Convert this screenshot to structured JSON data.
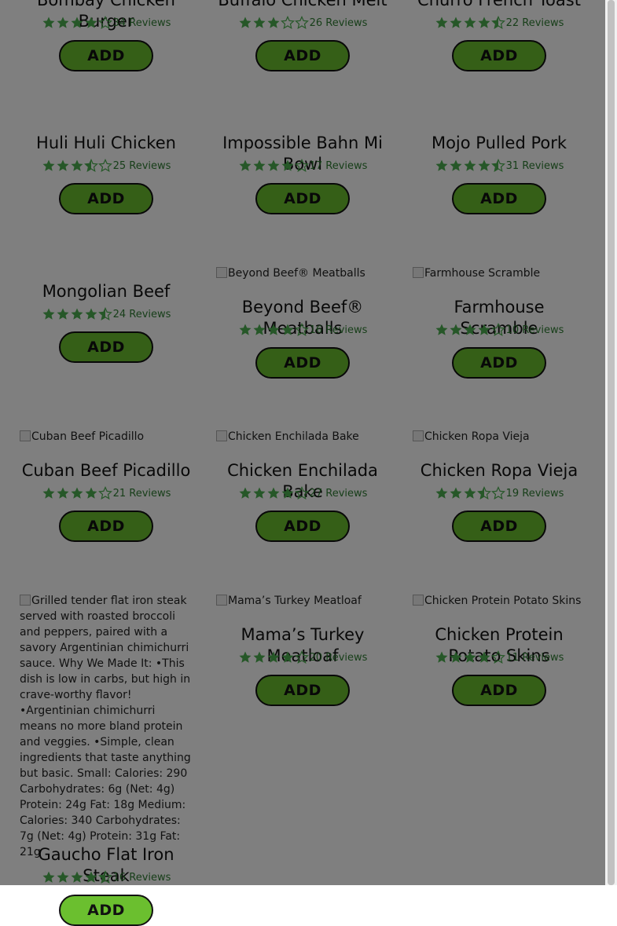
{
  "colors": {
    "star_fill": "#4caf50",
    "button_fill": "#6bbf2f",
    "overlay": "rgba(0,0,0,0.5)"
  },
  "add_label": "ADD",
  "products": [
    {
      "name": "Bombay Chicken Burger",
      "rating": 4,
      "reviews": "34 Reviews",
      "image_alt": ""
    },
    {
      "name": "Buffalo Chicken Melt",
      "rating": 3,
      "reviews": "26 Reviews",
      "image_alt": ""
    },
    {
      "name": "Churro French Toast",
      "rating": 4.5,
      "reviews": "22 Reviews",
      "image_alt": ""
    },
    {
      "name": "Huli Huli Chicken",
      "rating": 3.5,
      "reviews": "25 Reviews",
      "image_alt": ""
    },
    {
      "name": "Impossible Bahn Mi Bowl",
      "rating": 4,
      "reviews": "17 Reviews",
      "image_alt": ""
    },
    {
      "name": "Mojo Pulled Pork",
      "rating": 4.5,
      "reviews": "31 Reviews",
      "image_alt": ""
    },
    {
      "name": "Mongolian Beef",
      "rating": 4.5,
      "reviews": "24 Reviews",
      "image_alt": ""
    },
    {
      "name": "Beyond Beef® Meatballs",
      "rating": 4,
      "reviews": "16 Reviews",
      "image_alt": "Beyond Beef® Meatballs"
    },
    {
      "name": "Farmhouse Scramble",
      "rating": 4,
      "reviews": "10 Reviews",
      "image_alt": "Farmhouse Scramble"
    },
    {
      "name": "Cuban Beef Picadillo",
      "rating": 4,
      "reviews": "21 Reviews",
      "image_alt": "Cuban Beef Picadillo"
    },
    {
      "name": "Chicken Enchilada Bake",
      "rating": 4,
      "reviews": "27 Reviews",
      "image_alt": "Chicken Enchilada Bake"
    },
    {
      "name": "Chicken Ropa Vieja",
      "rating": 3.5,
      "reviews": "19 Reviews",
      "image_alt": "Chicken Ropa Vieja"
    },
    {
      "name": "Gaucho Flat Iron Steak",
      "rating": 4.5,
      "reviews": "16 Reviews",
      "image_alt": "Grilled tender flat iron steak served with roasted broccoli and peppers, paired with a savory Argentinian chimichurri sauce. Why We Made It: •This dish is low in carbs, but high in crave-worthy flavor! •Argentinian chimichurri means no more bland protein and veggies. •Simple, clean ingredients that taste anything but basic. Small: Calories: 290 Carbohydrates: 6g (Net: 4g) Protein: 24g Fat: 18g Medium: Calories: 340 Carbohydrates: 7g (Net: 4g) Protein: 31g Fat: 21g"
    },
    {
      "name": "Mama’s Turkey Meatloaf",
      "rating": 4,
      "reviews": "20 Reviews",
      "image_alt": "Mama’s Turkey Meatloaf"
    },
    {
      "name": "Chicken Protein Potato Skins",
      "rating": 4,
      "reviews": "11 Reviews",
      "image_alt": "Chicken Protein Potato Skins"
    }
  ]
}
